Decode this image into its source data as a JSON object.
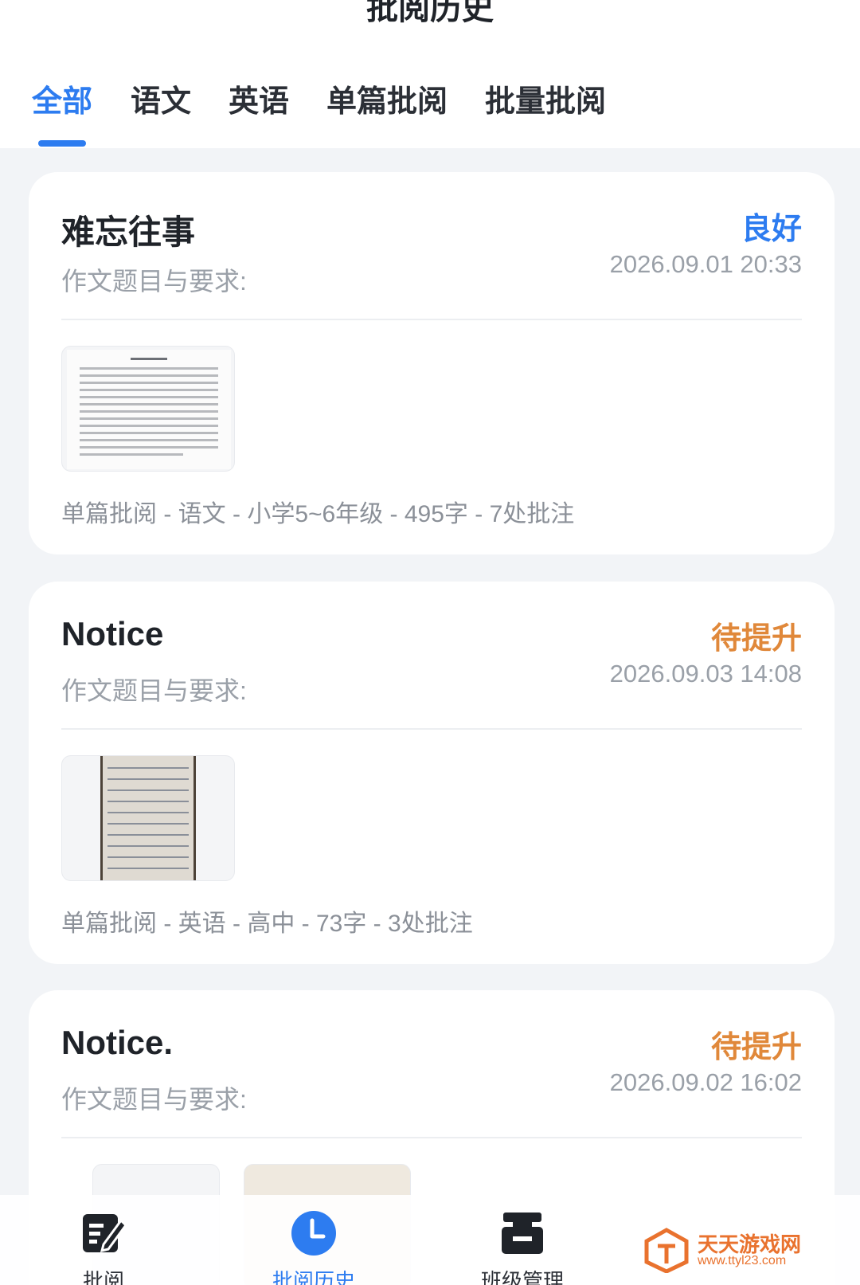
{
  "header": {
    "title": "批阅历史",
    "tabs": [
      {
        "label": "全部",
        "active": true
      },
      {
        "label": "语文",
        "active": false
      },
      {
        "label": "英语",
        "active": false
      },
      {
        "label": "单篇批阅",
        "active": false
      },
      {
        "label": "批量批阅",
        "active": false
      }
    ]
  },
  "cards": [
    {
      "title": "难忘往事",
      "subtitle": "作文题目与要求:",
      "status": "良好",
      "date": "2026.09.01 20:33",
      "meta": "单篇批阅 - 语文 - 小学5~6年级 - 495字 - 7处批注",
      "thumb_icon": "printed-document-thumbnail"
    },
    {
      "title": "Notice",
      "subtitle": "作文题目与要求:",
      "status": "待提升",
      "date": "2026.09.03 14:08",
      "meta": "单篇批阅 - 英语 - 高中 - 73字 - 3处批注",
      "thumb_icon": "handwritten-essay-thumbnail"
    },
    {
      "title": "Notice.",
      "subtitle": "作文题目与要求:",
      "status": "待提升",
      "date": "2026.09.02 16:02"
    }
  ],
  "bottom_nav": {
    "items": [
      {
        "label": "批阅",
        "icon": "edit-document-icon",
        "active": false
      },
      {
        "label": "批阅历史",
        "icon": "clock-icon",
        "active": true
      },
      {
        "label": "班级管理",
        "icon": "class-management-icon",
        "active": false
      }
    ]
  },
  "watermark": {
    "text": "天天游戏网",
    "url": "www.ttyl23.com"
  },
  "colors": {
    "accent": "#2d7cf0",
    "status_good": "#2d7cf0",
    "status_improve": "#e0883a",
    "background": "#f2f4f7"
  }
}
